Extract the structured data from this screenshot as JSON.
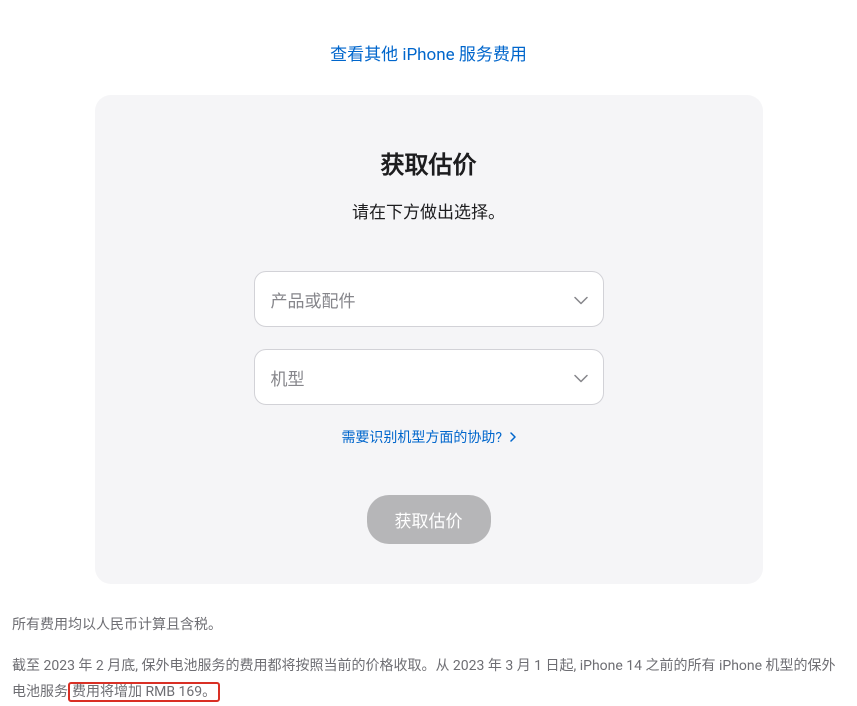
{
  "topLink": {
    "label": "查看其他 iPhone 服务费用"
  },
  "card": {
    "title": "获取估价",
    "subtitle": "请在下方做出选择。",
    "productSelect": {
      "placeholder": "产品或配件"
    },
    "modelSelect": {
      "placeholder": "机型"
    },
    "helpLink": {
      "label": "需要识别机型方面的协助?"
    },
    "submitButton": {
      "label": "获取估价"
    }
  },
  "footnotes": {
    "line1": "所有费用均以人民币计算且含税。",
    "line2_part1": "截至 2023 年 2 月底, 保外电池服务的费用都将按照当前的价格收取。从 2023 年 3 月 1 日起, iPhone 14 之前的所有 iPhone 机型的保外电池服务",
    "line2_highlight": "费用将增加 RMB 169。"
  }
}
